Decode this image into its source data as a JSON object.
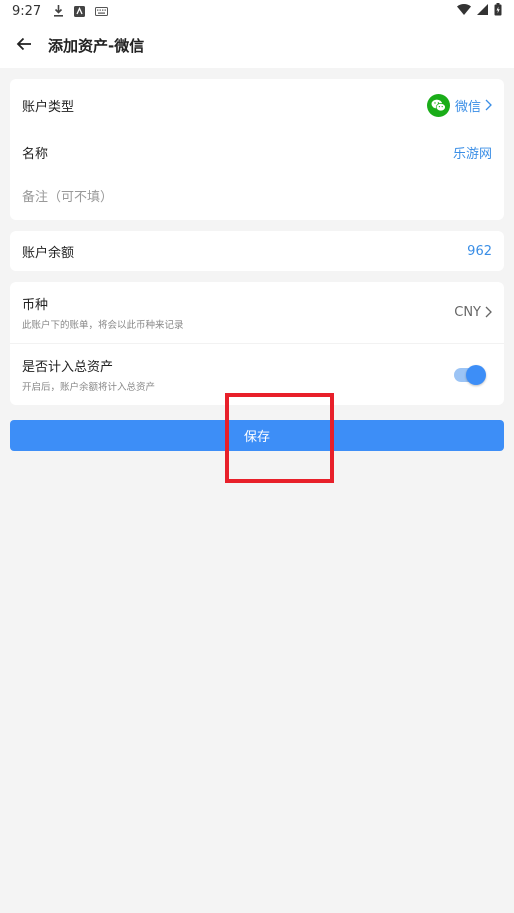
{
  "status_bar": {
    "time": "9:27"
  },
  "app_bar": {
    "title": "添加资产-微信"
  },
  "account_type": {
    "label": "账户类型",
    "value": "微信"
  },
  "name": {
    "label": "名称",
    "value": "乐游网"
  },
  "remark": {
    "placeholder": "备注（可不填）"
  },
  "balance": {
    "label": "账户余额",
    "value": "962"
  },
  "currency": {
    "label": "币种",
    "hint": "此账户下的账单，将会以此币种来记录",
    "value": "CNY"
  },
  "include_total": {
    "label": "是否计入总资产",
    "hint": "开启后，账户余额将计入总资产",
    "enabled": true
  },
  "save_button": {
    "label": "保存"
  },
  "colors": {
    "accent": "#3d8ef7",
    "link": "#3a8ee6",
    "wechat": "#1aad19",
    "highlight": "#e8202a"
  }
}
